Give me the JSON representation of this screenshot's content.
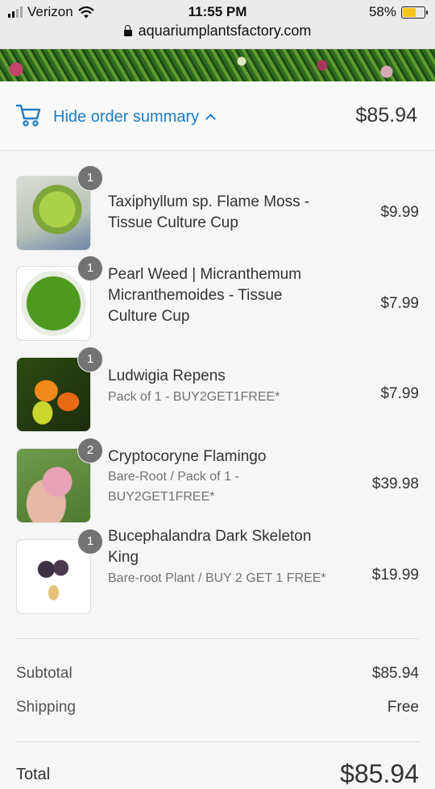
{
  "status_bar": {
    "carrier": "Verizon",
    "time": "11:55 PM",
    "battery_percent": "58%",
    "url": "aquariumplantsfactory.com"
  },
  "order_summary": {
    "toggle_label": "Hide order summary",
    "total": "$85.94"
  },
  "items": [
    {
      "name": "Taxiphyllum sp. Flame Moss - Tissue Culture Cup",
      "variant": "",
      "quantity": "1",
      "price": "$9.99"
    },
    {
      "name": "Pearl Weed | Micranthemum Micranthemoides - Tissue Culture Cup",
      "variant": "",
      "quantity": "1",
      "price": "$7.99"
    },
    {
      "name": "Ludwigia Repens",
      "variant": "Pack of 1 - BUY2GET1FREE*",
      "quantity": "1",
      "price": "$7.99"
    },
    {
      "name": "Cryptocoryne Flamingo",
      "variant": "Bare-Root / Pack of 1 - BUY2GET1FREE*",
      "quantity": "2",
      "price": "$39.98"
    },
    {
      "name": "Bucephalandra Dark Skeleton King",
      "variant": "Bare-root Plant / BUY 2 GET 1 FREE*",
      "quantity": "1",
      "price": "$19.99"
    }
  ],
  "totals": {
    "subtotal_label": "Subtotal",
    "subtotal_value": "$85.94",
    "shipping_label": "Shipping",
    "shipping_value": "Free",
    "total_label": "Total",
    "total_value": "$85.94"
  },
  "colors": {
    "accent": "#1f7cc2",
    "badge": "#737373"
  }
}
